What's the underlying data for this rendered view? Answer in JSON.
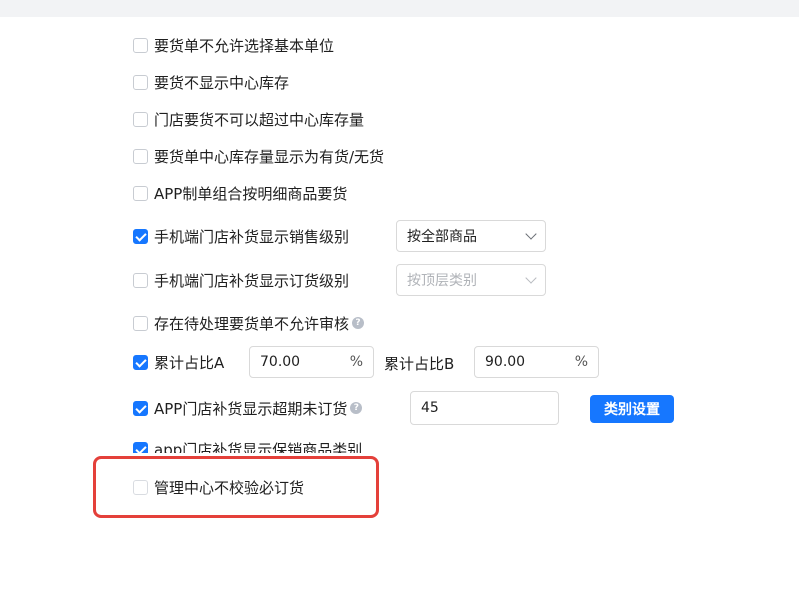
{
  "options": [
    {
      "label": "要货单不允许选择基本单位",
      "checked": false
    },
    {
      "label": "要货不显示中心库存",
      "checked": false
    },
    {
      "label": "门店要货不可以超过中心库存量",
      "checked": false
    },
    {
      "label": "要货单中心库存量显示为有货/无货",
      "checked": false
    },
    {
      "label": "APP制单组合按明细商品要货",
      "checked": false
    },
    {
      "label": "手机端门店补货显示销售级别",
      "checked": true
    },
    {
      "label": "手机端门店补货显示订货级别",
      "checked": false
    },
    {
      "label": "存在待处理要货单不允许审核",
      "checked": false
    },
    {
      "label": "累计占比A",
      "checked": true
    },
    {
      "label": "APP门店补货显示超期未订货",
      "checked": true
    },
    {
      "label": "app门店补货显示保销商品类别",
      "checked": true
    },
    {
      "label": "管理中心不校验必订货",
      "checked": false
    }
  ],
  "sales_level_select": {
    "value": "按全部商品"
  },
  "order_level_select": {
    "value": "按顶层类别"
  },
  "cum_a": {
    "value": "70.00",
    "suffix": "%"
  },
  "cum_b_label": "累计占比B",
  "cum_b": {
    "value": "90.00",
    "suffix": "%"
  },
  "overdue_days": {
    "value": "45"
  },
  "category_settings_button": "类别设置",
  "colors": {
    "primary": "#1677ff",
    "highlight": "#e4403a"
  }
}
